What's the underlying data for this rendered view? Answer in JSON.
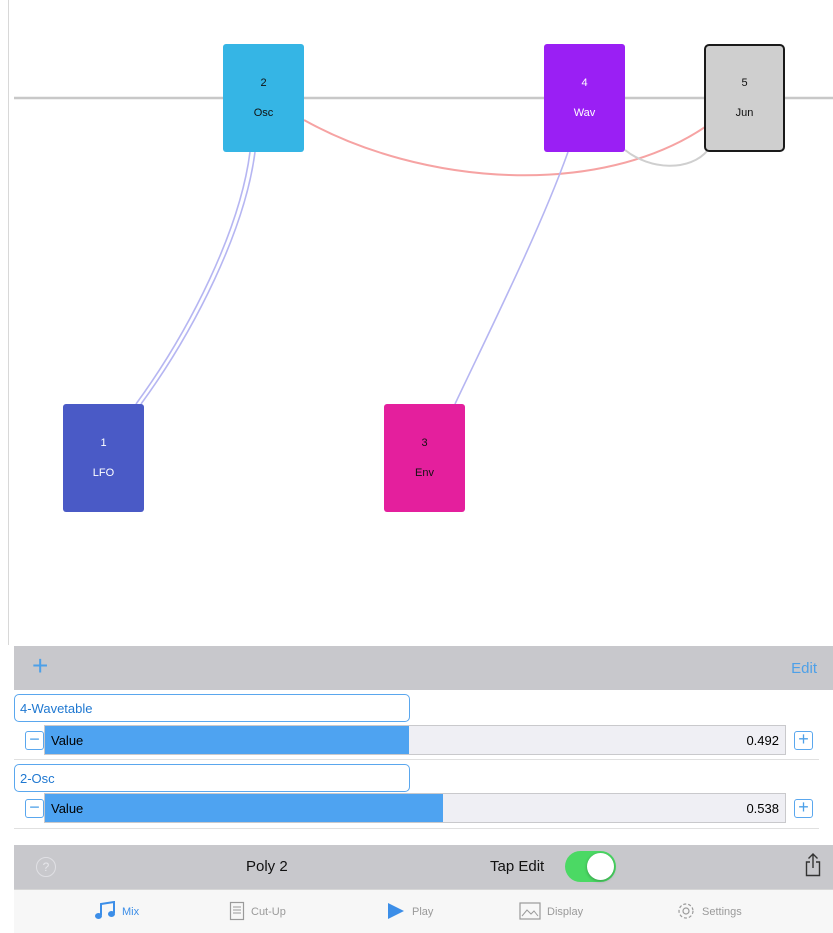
{
  "graph": {
    "nodes": [
      {
        "id": "lfo",
        "number": "1",
        "label": "LFO"
      },
      {
        "id": "osc",
        "number": "2",
        "label": "Osc"
      },
      {
        "id": "env",
        "number": "3",
        "label": "Env"
      },
      {
        "id": "wav",
        "number": "4",
        "label": "Wav"
      },
      {
        "id": "jun",
        "number": "5",
        "label": "Jun"
      }
    ]
  },
  "toolbar_top": {
    "add_label": "+",
    "edit_label": "Edit"
  },
  "params": [
    {
      "name": "4-Wavetable",
      "slider_label": "Value",
      "value": "0.492",
      "fraction": 0.492,
      "minus": "−",
      "plus": "+"
    },
    {
      "name": "2-Osc",
      "slider_label": "Value",
      "value": "0.538",
      "fraction": 0.538,
      "minus": "−",
      "plus": "+"
    }
  ],
  "toolbar_bottom": {
    "help_label": "?",
    "poly_label": "Poly 2",
    "tap_edit_label": "Tap Edit",
    "tap_edit_on": true
  },
  "tabs": [
    {
      "label": "Mix",
      "icon": "music-note-icon",
      "active": true
    },
    {
      "label": "Cut-Up",
      "icon": "document-icon",
      "active": false
    },
    {
      "label": "Play",
      "icon": "play-icon",
      "active": false
    },
    {
      "label": "Display",
      "icon": "image-icon",
      "active": false
    },
    {
      "label": "Settings",
      "icon": "gear-icon",
      "active": false
    }
  ],
  "colors": {
    "accent": "#4da0e8",
    "lfo": "#4a5ac6",
    "osc": "#35b5e5",
    "env": "#e41f9d",
    "wav": "#9a1ff4",
    "jun": "#cfcfcf",
    "slider_fill": "#4ea3f1",
    "toggle_on": "#4bd964"
  }
}
